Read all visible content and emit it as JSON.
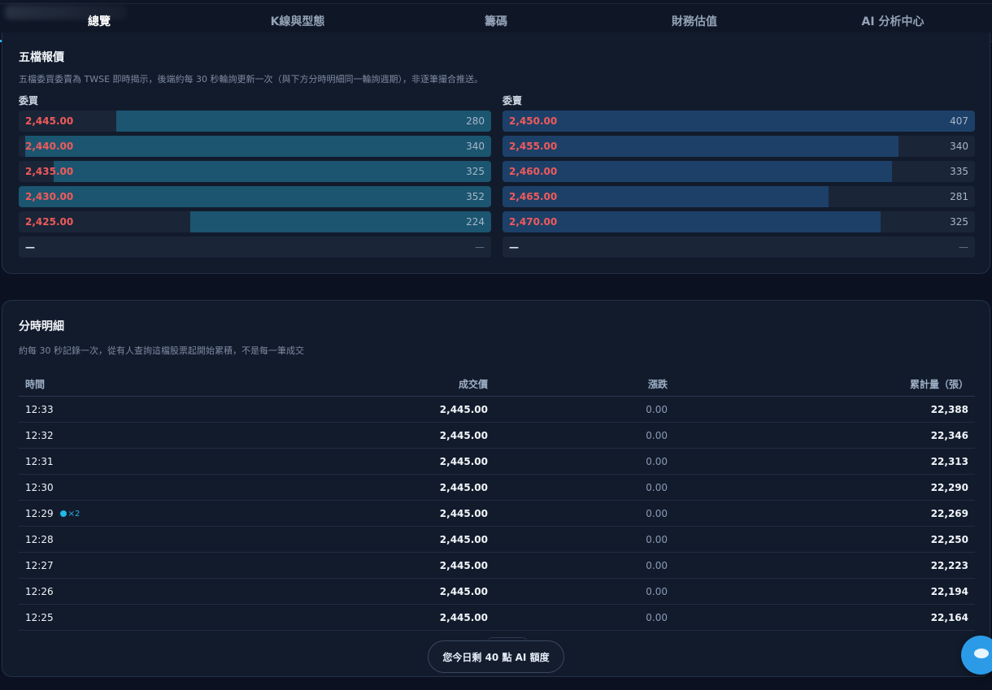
{
  "tabs": [
    {
      "label": "總覽",
      "active": true
    },
    {
      "label": "K線與型態",
      "active": false
    },
    {
      "label": "籌碼",
      "active": false
    },
    {
      "label": "財務估值",
      "active": false
    },
    {
      "label": "AI 分析中心",
      "active": false
    }
  ],
  "order_book": {
    "title": "五檔報價",
    "subtitle": "五檔委買委賣為 TWSE 即時揭示，後端約每 30 秒輪詢更新一次（與下方分時明細同一輪詢週期），非逐筆撮合推送。",
    "bid_label": "委買",
    "ask_label": "委賣",
    "max_volume": 407,
    "bids": [
      {
        "price": "2,445.00",
        "volume": "280",
        "fill": 0.794
      },
      {
        "price": "2,440.00",
        "volume": "340",
        "fill": 0.986
      },
      {
        "price": "2,435.00",
        "volume": "325",
        "fill": 0.926
      },
      {
        "price": "2,430.00",
        "volume": "352",
        "fill": 1.0
      },
      {
        "price": "2,425.00",
        "volume": "224",
        "fill": 0.637
      },
      {
        "price": "—",
        "volume": "—",
        "fill": 0
      }
    ],
    "asks": [
      {
        "price": "2,450.00",
        "volume": "407",
        "fill": 1.0
      },
      {
        "price": "2,455.00",
        "volume": "340",
        "fill": 0.838
      },
      {
        "price": "2,460.00",
        "volume": "335",
        "fill": 0.824
      },
      {
        "price": "2,465.00",
        "volume": "281",
        "fill": 0.691
      },
      {
        "price": "2,470.00",
        "volume": "325",
        "fill": 0.8
      },
      {
        "price": "—",
        "volume": "—",
        "fill": 0
      }
    ]
  },
  "intraday": {
    "title": "分時明細",
    "subtitle": "約每 30 秒記錄一次，從有人查詢這檔股票起開始累積，不是每一筆成交",
    "headers": {
      "time": "時間",
      "price": "成交價",
      "change": "漲跌",
      "volume": "累計量（張）"
    },
    "rows": [
      {
        "time": "12:33",
        "price": "2,445.00",
        "change": "0.00",
        "volume": "22,388",
        "marker": ""
      },
      {
        "time": "12:32",
        "price": "2,445.00",
        "change": "0.00",
        "volume": "22,346",
        "marker": ""
      },
      {
        "time": "12:31",
        "price": "2,445.00",
        "change": "0.00",
        "volume": "22,313",
        "marker": ""
      },
      {
        "time": "12:30",
        "price": "2,445.00",
        "change": "0.00",
        "volume": "22,290",
        "marker": ""
      },
      {
        "time": "12:29",
        "price": "2,445.00",
        "change": "0.00",
        "volume": "22,269",
        "marker": "×2"
      },
      {
        "time": "12:28",
        "price": "2,445.00",
        "change": "0.00",
        "volume": "22,250",
        "marker": ""
      },
      {
        "time": "12:27",
        "price": "2,445.00",
        "change": "0.00",
        "volume": "22,223",
        "marker": ""
      },
      {
        "time": "12:26",
        "price": "2,445.00",
        "change": "0.00",
        "volume": "22,194",
        "marker": ""
      },
      {
        "time": "12:25",
        "price": "2,445.00",
        "change": "0.00",
        "volume": "22,164",
        "marker": ""
      }
    ]
  },
  "quota": {
    "label": "您今日剩 40 點 AI 額度"
  },
  "colors": {
    "accent": "#22b8e6",
    "price_red": "#f05a5a",
    "bid_bar": "#1b5570",
    "ask_bar": "#1d4068",
    "background": "#0b1120"
  }
}
